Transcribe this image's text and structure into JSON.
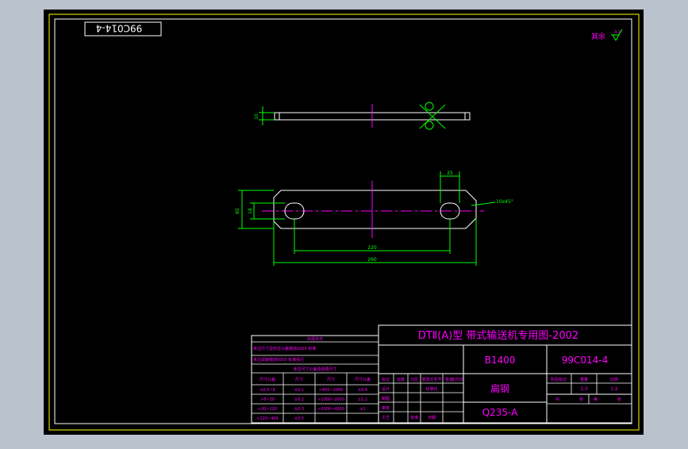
{
  "colors": {
    "background": "#b9c2cc",
    "canvas": "#000000",
    "border": "#ffff00",
    "outline": "#ffffff",
    "dimension": "#00ff00",
    "centerline": "#ff00ff",
    "text": "#ff00ff"
  },
  "drawing_code_rotated": "99C014-4",
  "roughness": {
    "label": "其余",
    "value": "3.2"
  },
  "dimensions": {
    "thickness": "10",
    "slot_width": "25",
    "height": "60",
    "slot_height": "18",
    "center_distance": "220",
    "overall_length": "260",
    "chamfer": "10x45°"
  },
  "tolerance_table": {
    "title": "补焊许可",
    "notes": [
      "未注尺寸及形位公差按JB1000 标准",
      "未注焊接按JB5000 标准执行"
    ],
    "subtitle": "未注尺寸公差及极限尺寸",
    "headers": [
      "尺寸公差",
      "尺寸",
      "尺寸",
      "尺寸公差"
    ],
    "rows": [
      [
        "≥0.5~6",
        "±0.1",
        ">400~1000",
        "±0.8"
      ],
      [
        ">6~30",
        "±0.2",
        ">1000~2000",
        "±1.2"
      ],
      [
        ">30~120",
        "±0.3",
        ">2000~4000",
        "±2"
      ],
      [
        ">120~400",
        "±0.5",
        "",
        ""
      ]
    ]
  },
  "title_block": {
    "title": "DTⅡ(A)型  带式输送机专用图-2002",
    "model": "B1400",
    "drawing_number": "99C014-4",
    "part_name": "扁钢",
    "material": "Q235-A",
    "sign_labels": [
      "标记",
      "处数",
      "分区",
      "更改文件号",
      "签名",
      "年月日"
    ],
    "sign_rows": [
      "设计",
      "制图",
      "审核",
      "工艺",
      "批准"
    ],
    "standardize": "标准化",
    "date_label": "日期",
    "stage_headers": [
      "阶段标记",
      "重量",
      "比例"
    ],
    "scale": "1:2",
    "weight": "1.3",
    "sheet_info": [
      "共",
      "张",
      "第",
      "张"
    ]
  }
}
